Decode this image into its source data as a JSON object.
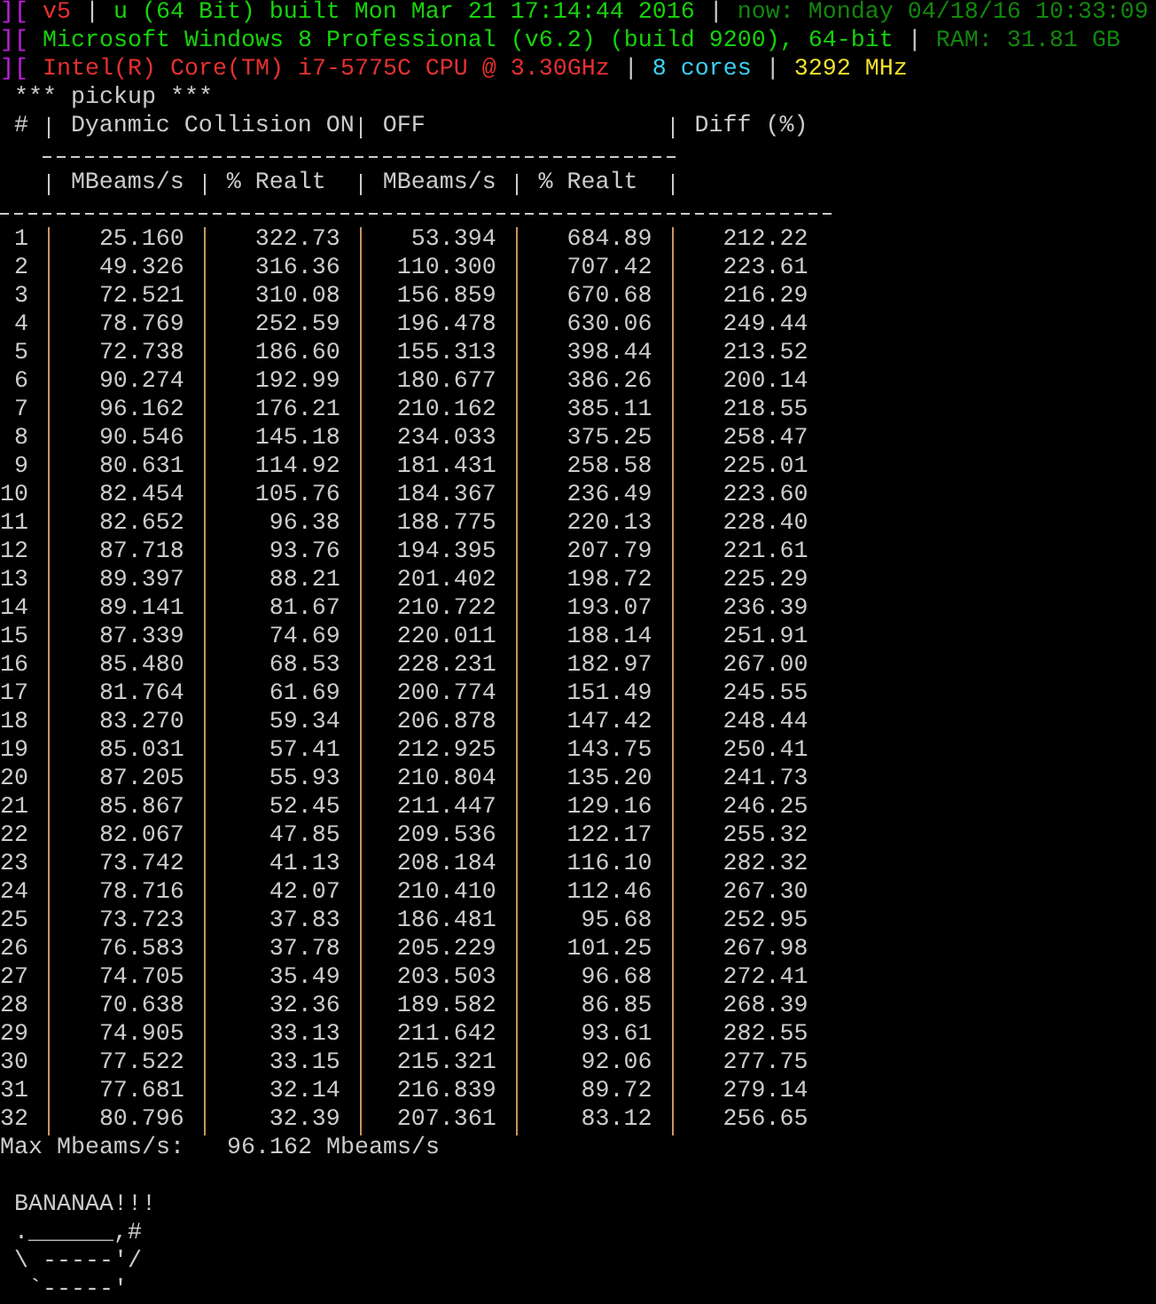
{
  "info_lines": [
    [
      {
        "text": "][",
        "color": "#c020e0"
      },
      {
        "text": "v5",
        "color": "#e83030"
      },
      {
        "text": "|",
        "color": "#cccccc"
      },
      {
        "text": "u (64 Bit) built Mon Mar 21 17:14:44 2016",
        "color": "#16d30c"
      },
      {
        "text": "|",
        "color": "#cccccc"
      },
      {
        "text": "now: Monday 04/18/16 10:33:09",
        "color": "#13870e"
      }
    ],
    [
      {
        "text": "][",
        "color": "#c020e0"
      },
      {
        "text": "Microsoft Windows 8 Professional (v6.2) (build 9200), 64-bit",
        "color": "#16d30c"
      },
      {
        "text": "|",
        "color": "#cccccc"
      },
      {
        "text": "RAM: 31.81 GB",
        "color": "#13870e"
      }
    ],
    [
      {
        "text": "][",
        "color": "#c020e0"
      },
      {
        "text": "Intel(R) Core(TM) i7-5775C CPU @ 3.30GHz",
        "color": "#e83030"
      },
      {
        "text": "|",
        "color": "#cccccc"
      },
      {
        "text": "8 cores",
        "color": "#3ad0f0"
      },
      {
        "text": "|",
        "color": "#cccccc"
      },
      {
        "text": "3292 MHz",
        "color": "#f0e030"
      }
    ]
  ],
  "table": {
    "title": "*** pickup ***",
    "columns": [
      "#",
      "Dyanmic Collision ON",
      "",
      "OFF",
      "",
      "Diff (%)"
    ],
    "subcolumns": [
      "",
      "MBeams/s",
      "% Realt",
      "MBeams/s",
      "% Realt",
      ""
    ],
    "rows": [
      [
        "1",
        "25.160",
        "322.73",
        "53.394",
        "684.89",
        "212.22"
      ],
      [
        "2",
        "49.326",
        "316.36",
        "110.300",
        "707.42",
        "223.61"
      ],
      [
        "3",
        "72.521",
        "310.08",
        "156.859",
        "670.68",
        "216.29"
      ],
      [
        "4",
        "78.769",
        "252.59",
        "196.478",
        "630.06",
        "249.44"
      ],
      [
        "5",
        "72.738",
        "186.60",
        "155.313",
        "398.44",
        "213.52"
      ],
      [
        "6",
        "90.274",
        "192.99",
        "180.677",
        "386.26",
        "200.14"
      ],
      [
        "7",
        "96.162",
        "176.21",
        "210.162",
        "385.11",
        "218.55"
      ],
      [
        "8",
        "90.546",
        "145.18",
        "234.033",
        "375.25",
        "258.47"
      ],
      [
        "9",
        "80.631",
        "114.92",
        "181.431",
        "258.58",
        "225.01"
      ],
      [
        "10",
        "82.454",
        "105.76",
        "184.367",
        "236.49",
        "223.60"
      ],
      [
        "11",
        "82.652",
        "96.38",
        "188.775",
        "220.13",
        "228.40"
      ],
      [
        "12",
        "87.718",
        "93.76",
        "194.395",
        "207.79",
        "221.61"
      ],
      [
        "13",
        "89.397",
        "88.21",
        "201.402",
        "198.72",
        "225.29"
      ],
      [
        "14",
        "89.141",
        "81.67",
        "210.722",
        "193.07",
        "236.39"
      ],
      [
        "15",
        "87.339",
        "74.69",
        "220.011",
        "188.14",
        "251.91"
      ],
      [
        "16",
        "85.480",
        "68.53",
        "228.231",
        "182.97",
        "267.00"
      ],
      [
        "17",
        "81.764",
        "61.69",
        "200.774",
        "151.49",
        "245.55"
      ],
      [
        "18",
        "83.270",
        "59.34",
        "206.878",
        "147.42",
        "248.44"
      ],
      [
        "19",
        "85.031",
        "57.41",
        "212.925",
        "143.75",
        "250.41"
      ],
      [
        "20",
        "87.205",
        "55.93",
        "210.804",
        "135.20",
        "241.73"
      ],
      [
        "21",
        "85.867",
        "52.45",
        "211.447",
        "129.16",
        "246.25"
      ],
      [
        "22",
        "82.067",
        "47.85",
        "209.536",
        "122.17",
        "255.32"
      ],
      [
        "23",
        "73.742",
        "41.13",
        "208.184",
        "116.10",
        "282.32"
      ],
      [
        "24",
        "78.716",
        "42.07",
        "210.410",
        "112.46",
        "267.30"
      ],
      [
        "25",
        "73.723",
        "37.83",
        "186.481",
        "95.68",
        "252.95"
      ],
      [
        "26",
        "76.583",
        "37.78",
        "205.229",
        "101.25",
        "267.98"
      ],
      [
        "27",
        "74.705",
        "35.49",
        "203.503",
        "96.68",
        "272.41"
      ],
      [
        "28",
        "70.638",
        "32.36",
        "189.582",
        "86.85",
        "268.39"
      ],
      [
        "29",
        "74.905",
        "33.13",
        "211.642",
        "93.61",
        "282.55"
      ],
      [
        "30",
        "77.522",
        "33.15",
        "215.321",
        "92.06",
        "277.75"
      ],
      [
        "31",
        "77.681",
        "32.14",
        "216.839",
        "89.72",
        "279.14"
      ],
      [
        "32",
        "80.796",
        "32.39",
        "207.361",
        "83.12",
        "256.65"
      ]
    ]
  },
  "max": {
    "label": "Max Mbeams/s:",
    "value": "96.162 Mbeams/s"
  },
  "banner": "BANANAA!!!",
  "art": [
    ".______,#",
    "\\ -----'/",
    " `-----'"
  ]
}
